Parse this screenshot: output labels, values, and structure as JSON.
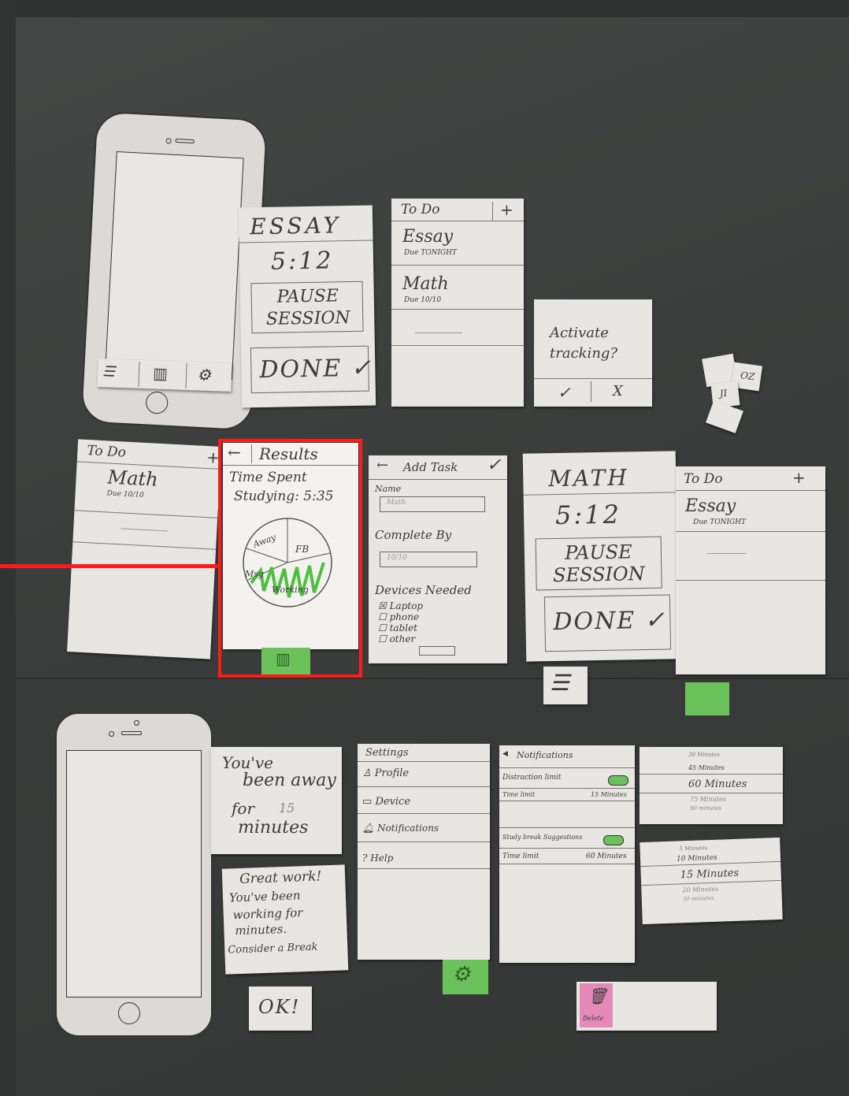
{
  "essay_timer": {
    "title": "ESSAY",
    "time": "5:12",
    "pause": "PAUSE SESSION",
    "done": "DONE ✓"
  },
  "todo_top": {
    "header": "To Do",
    "plus": "+",
    "item1": "Essay",
    "item1_due": "Due TONIGHT",
    "item2": "Math",
    "item2_due": "Due 10/10"
  },
  "activate": {
    "question": "Activate tracking?",
    "yes": "✓",
    "no": "X"
  },
  "chips": {
    "a": "JI",
    "b": "OZ"
  },
  "todo_mid": {
    "header": "To Do",
    "plus": "+",
    "item1": "Math",
    "item1_due": "Due 10/10"
  },
  "results": {
    "back": "←",
    "title": "Results",
    "line1": "Time Spent",
    "line2": "Studying: 5:35",
    "pie": [
      "Away",
      "FB",
      "Msg",
      "Working"
    ]
  },
  "add_task": {
    "back": "←",
    "title": "Add Task",
    "check": "✓",
    "name_label": "Name",
    "name_value": "Math",
    "complete_label": "Complete By",
    "complete_value": "10/10",
    "devices_label": "Devices Needed",
    "devices": [
      "Laptop",
      "phone",
      "tablet",
      "other"
    ]
  },
  "math_timer": {
    "title": "MATH",
    "time": "5:12",
    "pause": "PAUSE SESSION",
    "done": "DONE ✓"
  },
  "todo_right": {
    "header": "To Do",
    "plus": "+",
    "item1": "Essay",
    "item1_due": "Due TONIGHT"
  },
  "away_popup": {
    "line1": "You've",
    "line2": "been away",
    "line3": "for",
    "line3b": "15",
    "line4": "minutes"
  },
  "break_popup": {
    "line1": "Great work!",
    "line2": "You've been",
    "line3": "working for",
    "line4": "minutes.",
    "line5": "Consider a Break"
  },
  "ok_button": {
    "label": "OK!"
  },
  "settings": {
    "title": "Settings",
    "items": [
      "Profile",
      "Device",
      "Notifications",
      "Help"
    ]
  },
  "notifications": {
    "title": "Notifications",
    "distraction": "Distraction limit",
    "time_limit": "Time limit",
    "time_limit_value": "15 Minutes",
    "study_break": "Study break Suggestions",
    "time_limit2": "Time limit",
    "time_limit2_value": "60 Minutes"
  },
  "picker_top": {
    "options": [
      "30 Minutes",
      "45 Minutes",
      "60 Minutes",
      "75 Minutes",
      "90 minutes"
    ]
  },
  "picker_bottom": {
    "options": [
      "5 Minutes",
      "10 Minutes",
      "15 Minutes",
      "20 Minutes",
      "30 minutes"
    ]
  },
  "delete_card": {
    "label": "Delete"
  },
  "colors": {
    "red": "#ff1a1a",
    "green": "#6cc25a",
    "pink": "#e58ab6"
  }
}
